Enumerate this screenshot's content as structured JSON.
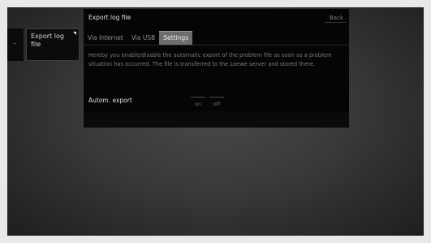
{
  "sidebar": {
    "stub_glyph": "–",
    "menu_item": {
      "label": "Export log file",
      "corner_icon": "triangle-corner-icon"
    }
  },
  "dialog": {
    "title": "Export log file",
    "back_label": "Back",
    "tabs": [
      {
        "label": "Via Internet",
        "active": false
      },
      {
        "label": "Via USB",
        "active": false
      },
      {
        "label": "Settings",
        "active": true
      }
    ],
    "description": "Hereby you enable/disable the automatic export of the problem file as soon as a problem situation has occurred. The file is transferred to the Loewe server and stored there.",
    "setting": {
      "label": "Autom. export",
      "options": [
        "on",
        "off"
      ]
    }
  },
  "colors": {
    "dialog_bg": "#050505",
    "active_tab_bg": "#6d6d6d",
    "screen_bg": "#3a3939"
  }
}
